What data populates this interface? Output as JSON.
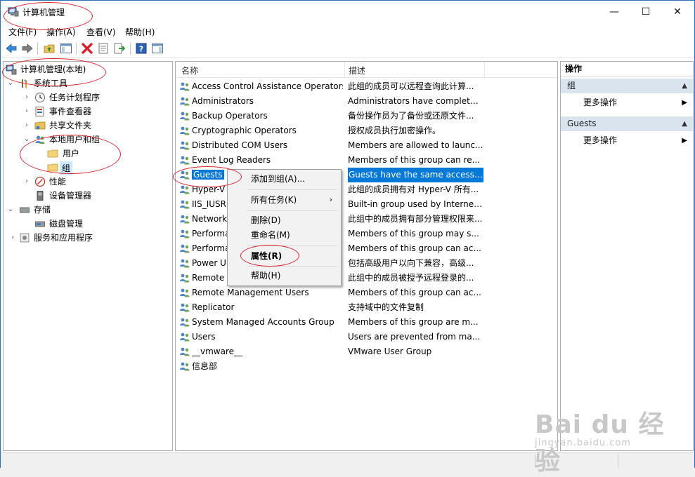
{
  "window": {
    "title": "计算机管理",
    "controls": {
      "minimize": "—",
      "maximize": "☐",
      "close": "✕"
    }
  },
  "menubar": [
    "文件(F)",
    "操作(A)",
    "查看(V)",
    "帮助(H)"
  ],
  "toolbar": {
    "icons": [
      "back-arrow-icon",
      "forward-arrow-icon",
      "up-folder-icon",
      "show-hide-tree-icon",
      "delete-icon",
      "properties-icon",
      "export-list-icon",
      "help-icon",
      "action-pane-icon"
    ]
  },
  "tree": {
    "root": "计算机管理(本地)",
    "system_tools": "系统工具",
    "task_scheduler": "任务计划程序",
    "event_viewer": "事件查看器",
    "shared_folders": "共享文件夹",
    "local_users_groups": "本地用户和组",
    "users": "用户",
    "groups": "组",
    "performance": "性能",
    "device_manager": "设备管理器",
    "storage": "存储",
    "disk_management": "磁盘管理",
    "services_apps": "服务和应用程序"
  },
  "list": {
    "col_name": "名称",
    "col_desc": "描述",
    "rows": [
      {
        "name": "Access Control Assistance Operators",
        "desc": "此组的成员可以远程查询此计算..."
      },
      {
        "name": "Administrators",
        "desc": "Administrators have complete ..."
      },
      {
        "name": "Backup Operators",
        "desc": "备份操作员为了备份或还原文件..."
      },
      {
        "name": "Cryptographic Operators",
        "desc": "授权成员执行加密操作。"
      },
      {
        "name": "Distributed COM Users",
        "desc": "Members are allowed to launc..."
      },
      {
        "name": "Event Log Readers",
        "desc": "Members of this group can re..."
      },
      {
        "name": "Guests",
        "desc": "Guests have the same access ..."
      },
      {
        "name": "Hyper-V",
        "desc": "此组的成员拥有对 Hyper-V 所有..."
      },
      {
        "name": "IIS_IUSR",
        "desc": "Built-in group used by Internet..."
      },
      {
        "name": "Network",
        "desc": "此组中的成员拥有部分管理权限来..."
      },
      {
        "name": "Performa",
        "desc": "Members of this group may s..."
      },
      {
        "name": "Performa",
        "desc": "Members of this group can ac..."
      },
      {
        "name": "Power U",
        "desc": "包括高级用户以向下兼容，高级..."
      },
      {
        "name": "Remote",
        "desc": "此组中的成员被授予远程登录的..."
      },
      {
        "name": "Remote Management Users",
        "desc": "Members of this group can ac..."
      },
      {
        "name": "Replicator",
        "desc": "支持域中的文件复制"
      },
      {
        "name": "System Managed Accounts Group",
        "desc": "Members of this group are m..."
      },
      {
        "name": "Users",
        "desc": "Users are prevented from ma..."
      },
      {
        "name": "__vmware__",
        "desc": "VMware User Group"
      },
      {
        "name": "信息部",
        "desc": ""
      }
    ]
  },
  "context_menu": {
    "add_to_group": "添加到组(A)...",
    "all_tasks": "所有任务(K)",
    "delete": "删除(D)",
    "rename": "重命名(M)",
    "properties": "属性(R)",
    "help": "帮助(H)"
  },
  "actions": {
    "title": "操作",
    "section1": "组",
    "section1_more": "更多操作",
    "section2": "Guests",
    "section2_more": "更多操作"
  },
  "watermark": {
    "brand": "Bai du 经验",
    "url": "jingyan.baidu.com"
  },
  "colors": {
    "selection": "#0078d7",
    "tree_selection": "#cce8ff",
    "annotation": "#d9272e",
    "section_band": "#d9e4ef"
  }
}
